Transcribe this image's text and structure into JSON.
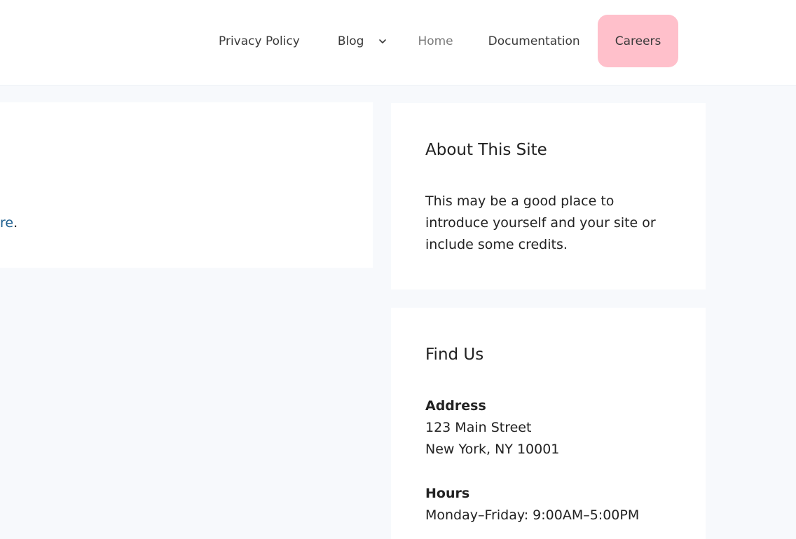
{
  "nav": {
    "items": [
      {
        "label": "Privacy Policy"
      },
      {
        "label": "Blog"
      },
      {
        "label": "Home"
      },
      {
        "label": "Documentation"
      },
      {
        "label": "Careers"
      }
    ],
    "careers_bg": "#ffc0cb"
  },
  "main": {
    "link_fragment": "re",
    "punctuation": "."
  },
  "sidebar": {
    "about": {
      "title": "About This Site",
      "text": "This may be a good place to introduce yourself and your site or include some credits."
    },
    "find_us": {
      "title": "Find Us",
      "address_heading": "Address",
      "address_line1": "123 Main Street",
      "address_line2": "New York, NY 10001",
      "hours_heading": "Hours",
      "hours_line1": "Monday–Friday: 9:00AM–5:00PM"
    }
  }
}
